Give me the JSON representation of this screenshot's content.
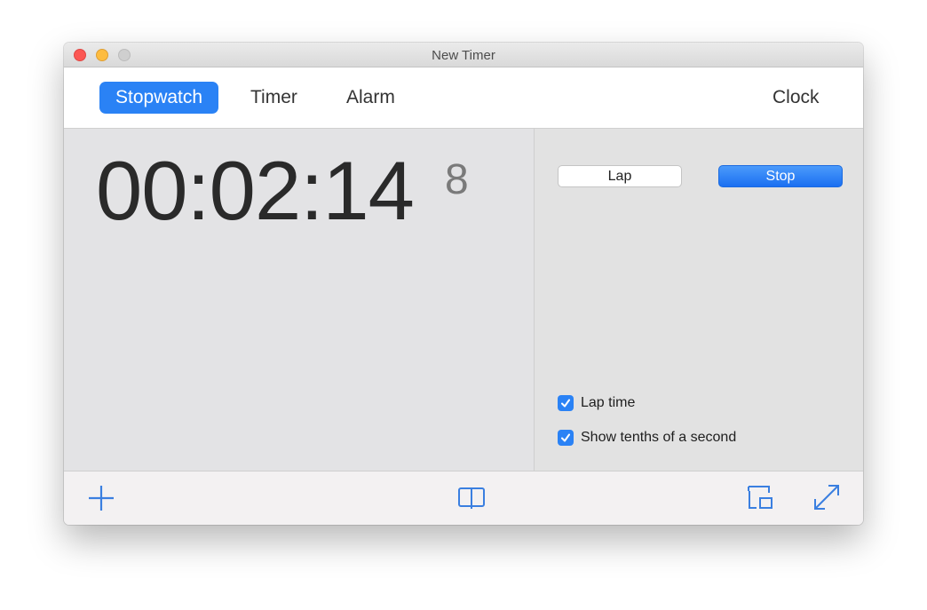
{
  "window": {
    "title": "New Timer",
    "controls": [
      "close",
      "minimize",
      "zoom"
    ]
  },
  "tabs": [
    {
      "label": "Stopwatch",
      "active": true
    },
    {
      "label": "Timer",
      "active": false
    },
    {
      "label": "Alarm",
      "active": false
    },
    {
      "label": "Clock",
      "active": false
    }
  ],
  "stopwatch": {
    "time": "00:02:14",
    "tenths": "8"
  },
  "controls": {
    "lap_label": "Lap",
    "stop_label": "Stop"
  },
  "options": [
    {
      "label": "Lap time",
      "checked": true
    },
    {
      "label": "Show tenths of a second",
      "checked": true
    }
  ],
  "toolbar": {
    "icons": [
      "plus-icon",
      "book-icon",
      "picture-in-picture-icon",
      "fullscreen-icon"
    ]
  },
  "colors": {
    "accent": "#2a82f5",
    "icon_blue": "#3a7fe0"
  }
}
